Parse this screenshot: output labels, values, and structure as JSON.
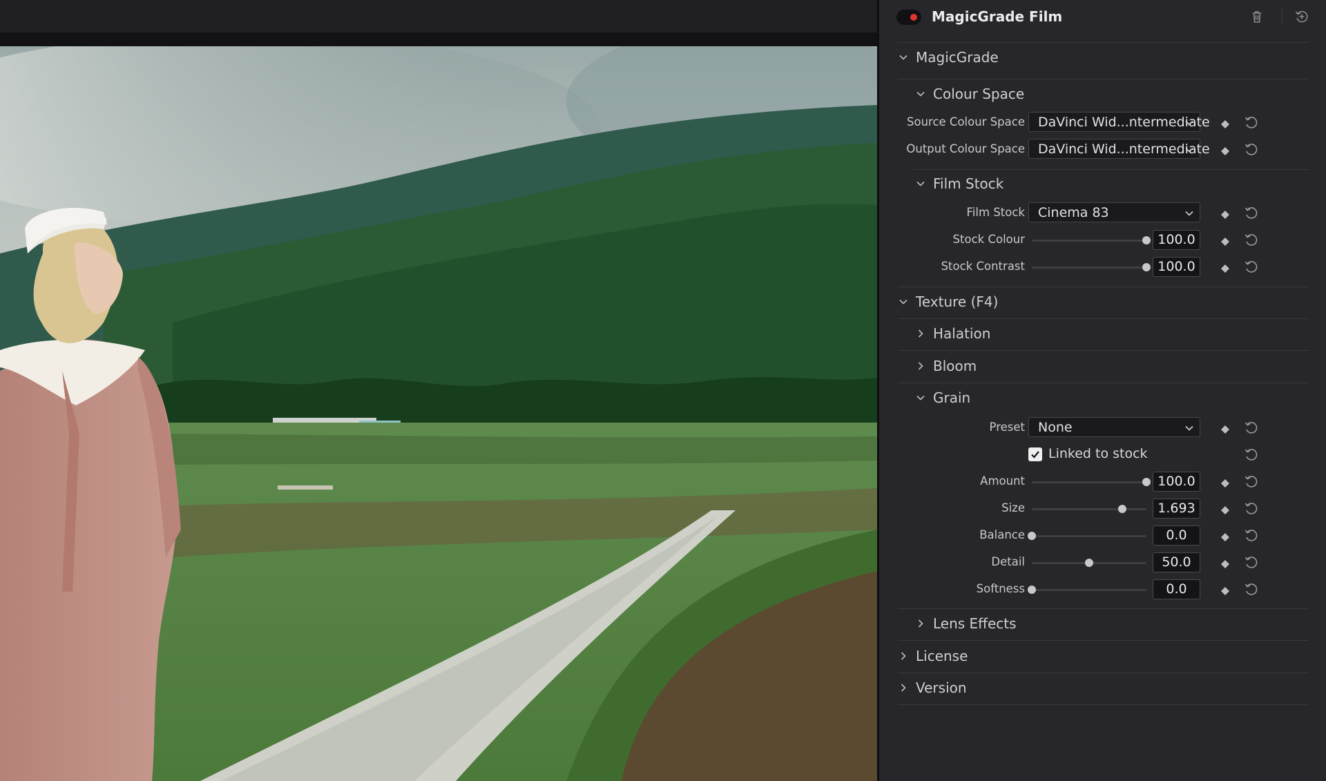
{
  "panel": {
    "title": "MagicGrade Film",
    "sections": {
      "magicgrade": "MagicGrade",
      "colour_space": "Colour Space",
      "film_stock": "Film Stock",
      "texture": "Texture (F4)",
      "halation": "Halation",
      "bloom": "Bloom",
      "grain": "Grain",
      "lens_effects": "Lens Effects",
      "license": "License",
      "version": "Version"
    },
    "colour_space": {
      "source_label": "Source Colour Space",
      "source_value": "DaVinci Wid...ntermediate",
      "output_label": "Output Colour Space",
      "output_value": "DaVinci Wid...ntermediate"
    },
    "film_stock": {
      "stock_label": "Film Stock",
      "stock_value": "Cinema 83",
      "colour_label": "Stock Colour",
      "colour_value": "100.0",
      "colour_level": 1.0,
      "contrast_label": "Stock Contrast",
      "contrast_value": "100.0",
      "contrast_level": 1.0
    },
    "grain": {
      "preset_label": "Preset",
      "preset_value": "None",
      "linked_label": "Linked to stock",
      "linked_checked": true,
      "amount_label": "Amount",
      "amount_value": "100.0",
      "amount_level": 1.0,
      "size_label": "Size",
      "size_value": "1.693",
      "size_level": 0.79,
      "balance_label": "Balance",
      "balance_value": "0.0",
      "balance_level": 0.0,
      "detail_label": "Detail",
      "detail_value": "50.0",
      "detail_level": 0.5,
      "softness_label": "Softness",
      "softness_value": "0.0",
      "softness_level": 0.0
    }
  },
  "icons": {
    "header": [
      "toggle-switch",
      "trash-icon",
      "reset-all-icon"
    ],
    "rows": [
      "keyframe-diamond-icon",
      "reset-icon",
      "chevron-down-icon",
      "chevron-right-icon",
      "dropdown-caret-icon"
    ]
  },
  "colors": {
    "panel_bg": "#27272b",
    "field_bg": "#141416",
    "toggle_dot": "#e0352f",
    "divider": "#38383d"
  }
}
